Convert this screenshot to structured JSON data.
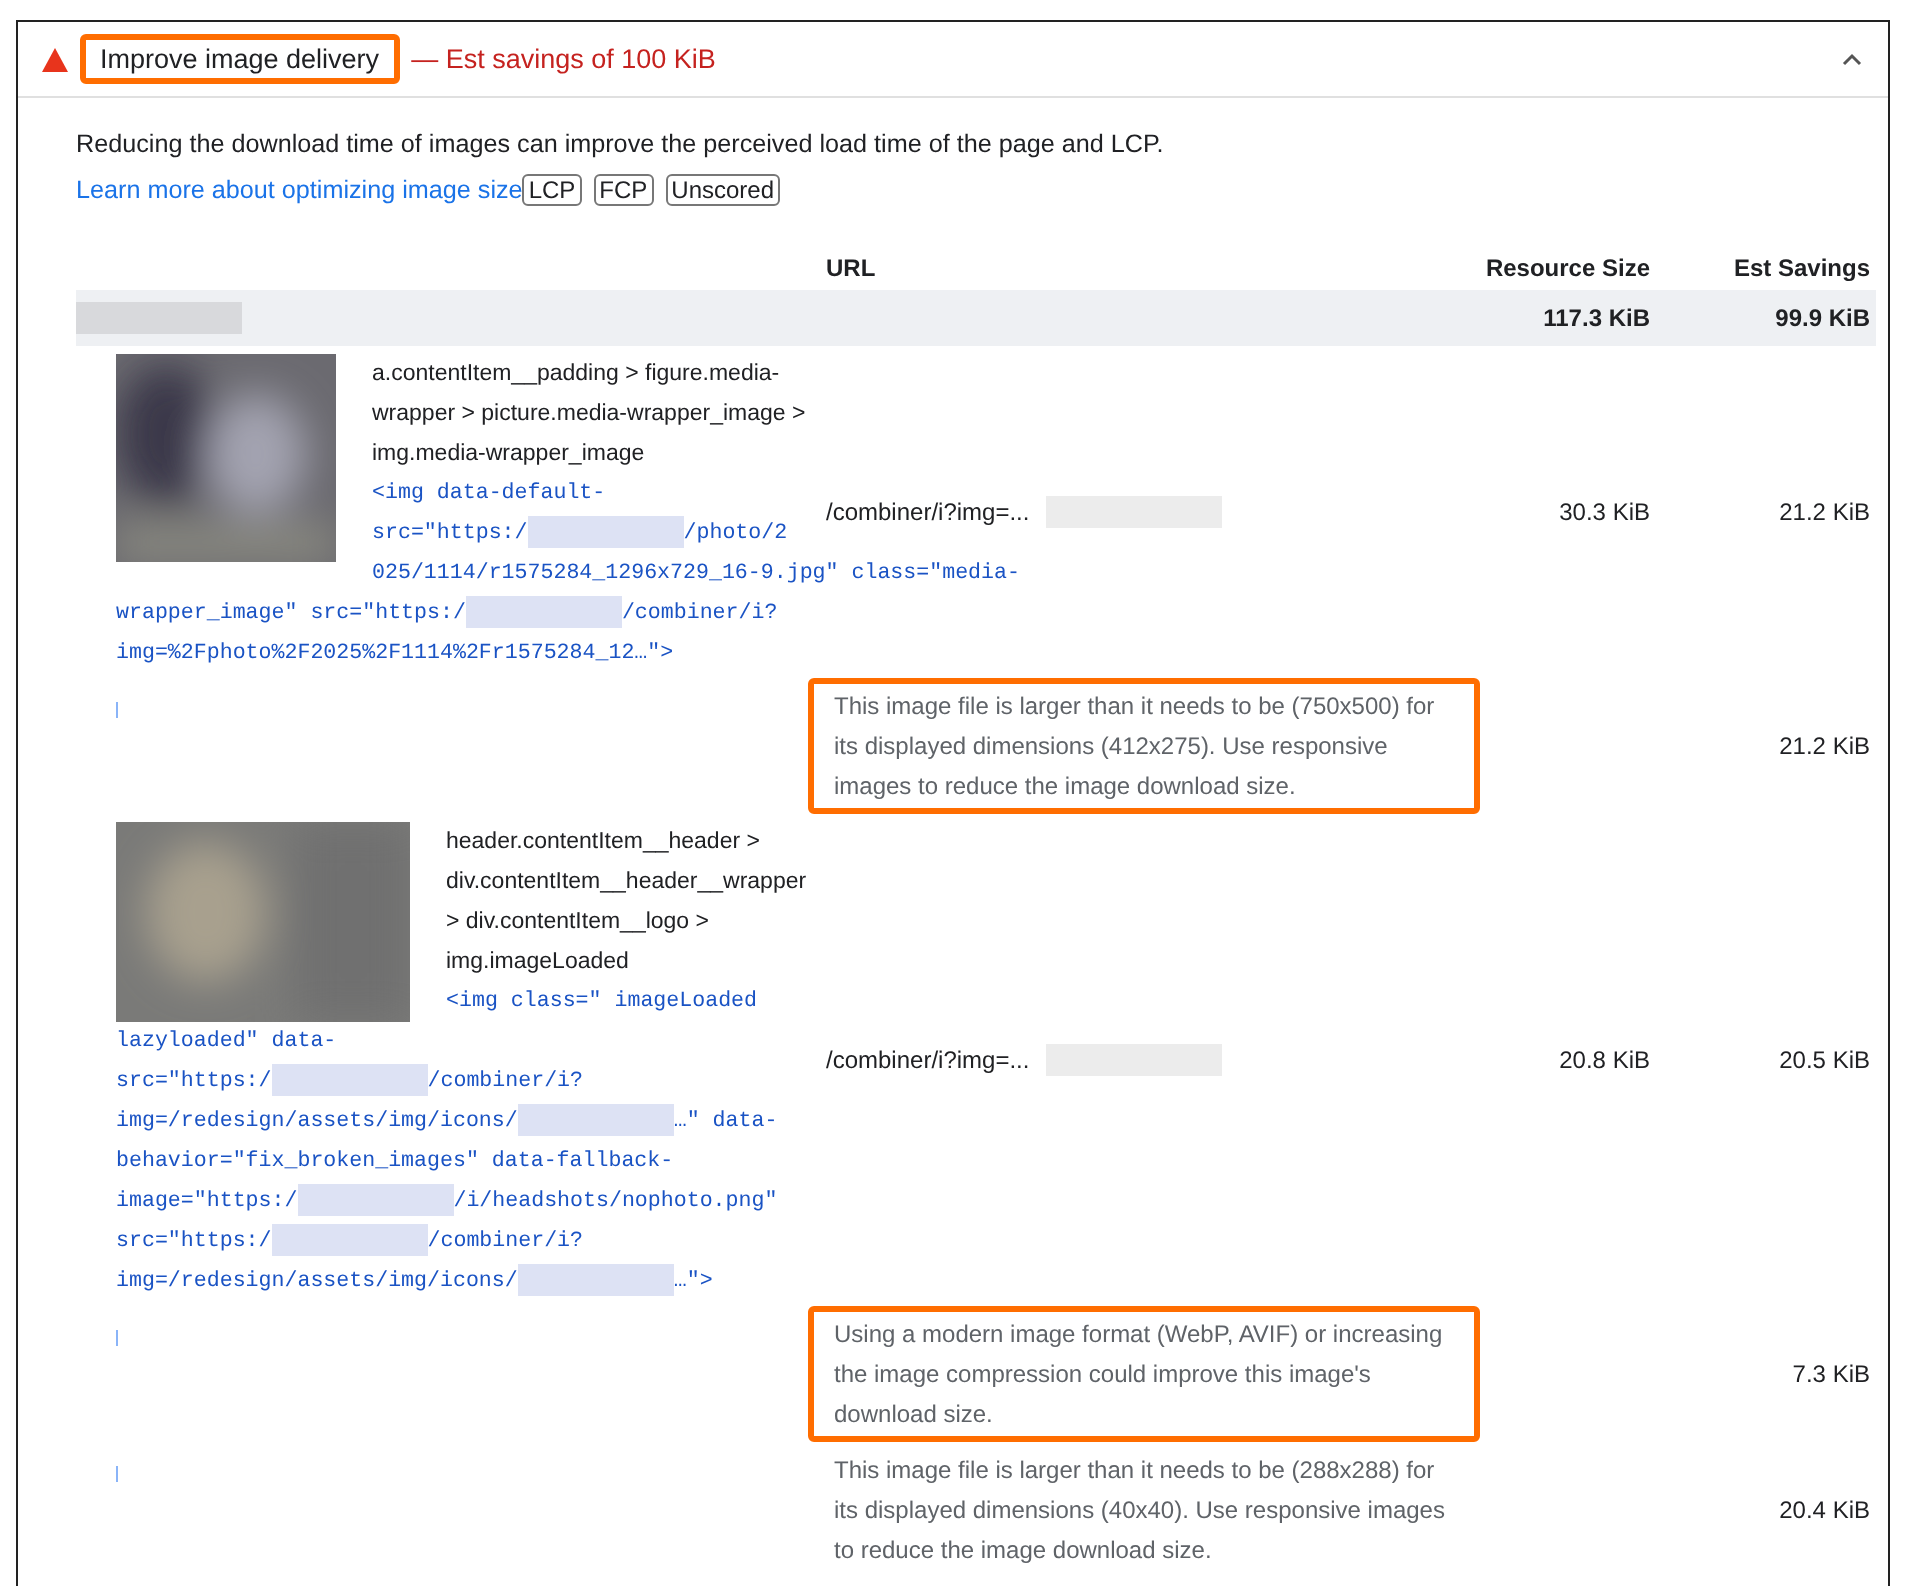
{
  "audit": {
    "title": "Improve image delivery",
    "title_highlighted": true,
    "savings": "— Est savings of 100 KiB",
    "expanded": true
  },
  "description": {
    "text": "Reducing the download time of images can improve the perceived load time of the page and LCP.",
    "link": "Learn more about optimizing image size",
    "badges": [
      "LCP",
      "FCP",
      "Unscored"
    ]
  },
  "table": {
    "columns": [
      "URL",
      "Resource Size",
      "Est Savings"
    ],
    "group": {
      "resource_size": "117.3 KiB",
      "est_savings": "99.9 KiB"
    },
    "items": [
      {
        "selector": "a.contentItem__padding > figure.media-wrapper > picture.media-wrapper_image > img.media-wrapper_image",
        "snippet": [
          [
            {
              "text": "<img data-default-"
            }
          ],
          [
            {
              "text": "src=\"https:/"
            },
            {
              "kind": "redacted"
            },
            {
              "text": "/photo/2"
            }
          ],
          [
            {
              "text": "025/1114/r1575284_1296x729_16-9.jpg\" class=\"media-"
            }
          ],
          [
            {
              "text": "wrapper_image\" src=\"https:/"
            },
            {
              "kind": "redacted"
            },
            {
              "text": "/combiner/i?"
            }
          ],
          [
            {
              "text": "img=%2Fphoto%2F2025%2F1114%2Fr1575284_12…\">"
            }
          ]
        ],
        "url": "/combiner/i?img=...",
        "resource_size": "30.3 KiB",
        "est_savings": "21.2 KiB",
        "subitems": [
          {
            "message": "This image file is larger than it needs to be (750x500) for its displayed dimensions (412x275). Use responsive images to reduce the image download size.",
            "est_savings": "21.2 KiB",
            "highlighted": true
          }
        ]
      },
      {
        "selector": "header.contentItem__header > div.contentItem__header__wrapper > div.contentItem__logo > img.imageLoaded",
        "snippet": [
          [
            {
              "text": "<img class=\" imageLoaded"
            }
          ],
          [
            {
              "text": "lazyloaded\" data-"
            }
          ],
          [
            {
              "text": "src=\"https:/"
            },
            {
              "kind": "redacted"
            },
            {
              "text": "/combiner/i?"
            }
          ],
          [
            {
              "text": "img=/redesign/assets/img/icons/"
            },
            {
              "kind": "redacted"
            },
            {
              "text": "…\" data-"
            }
          ],
          [
            {
              "text": "behavior=\"fix_broken_images\" data-fallback-"
            }
          ],
          [
            {
              "text": "image=\"https:/"
            },
            {
              "kind": "redacted"
            },
            {
              "text": "/i/headshots/nophoto.png\""
            }
          ],
          [
            {
              "text": "src=\"https:/"
            },
            {
              "kind": "redacted"
            },
            {
              "text": "/combiner/i?"
            }
          ],
          [
            {
              "text": "img=/redesign/assets/img/icons/"
            },
            {
              "kind": "redacted"
            },
            {
              "text": "…\">"
            }
          ]
        ],
        "url": "/combiner/i?img=...",
        "resource_size": "20.8 KiB",
        "est_savings": "20.5 KiB",
        "subitems": [
          {
            "message": "Using a modern image format (WebP, AVIF) or increasing the image compression could improve this image's download size.",
            "est_savings": "7.3 KiB",
            "highlighted": true
          },
          {
            "message": "This image file is larger than it needs to be (288x288) for its displayed dimensions (40x40). Use responsive images to reduce the image download size.",
            "est_savings": "20.4 KiB",
            "highlighted": false
          }
        ]
      }
    ]
  }
}
